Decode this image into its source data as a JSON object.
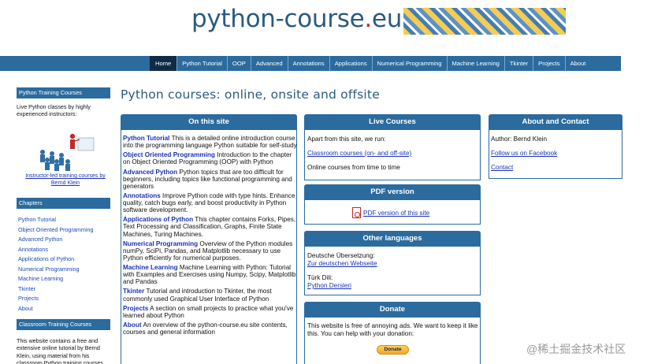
{
  "header": {
    "logo_main": "python-course",
    "logo_dot": ".",
    "logo_tld": "eu"
  },
  "nav": {
    "items": [
      "Home",
      "Python Tutorial",
      "OOP",
      "Advanced",
      "Annotations",
      "Applications",
      "Numerical Programming",
      "Machine Learning",
      "Tkinter",
      "Projects",
      "About"
    ]
  },
  "sidebar": {
    "training_head": "Python Training Courses",
    "training_text": "Live Python classes by highly experienced instructors:",
    "training_link": "Instructor-led training courses by Bernd Klein",
    "chapters_head": "Chapters",
    "chapters": [
      "Python Tutorial",
      "Object Oriented Programming",
      "Advanced Python",
      "Annotations",
      "Applications of Python",
      "Numerical Programming",
      "Machine Learning",
      "Tkinter",
      "Projects",
      "About"
    ],
    "classroom_head": "Classroom Training Courses",
    "classroom_text": "This website contains a free and extensive online tutorial by Bernd Klein, using material from his classroom Python training courses."
  },
  "main": {
    "title": "Python courses: online, onsite and offsite",
    "on_this_site": {
      "head": "On this site",
      "entries": [
        {
          "title": "Python Tutorial",
          "text": " This is a detailed online introduction course into the programming language Python suitable for self-study"
        },
        {
          "title": "Object Oriented Programming",
          "text": " Introduction to the chapter on Object Oriented Programming (OOP) with Python"
        },
        {
          "title": "Advanced Python",
          "text": " Python topics that are too difficult for beginners, including topics like functional programming and generators"
        },
        {
          "title": "Annotations",
          "text": " Improve Python code with type hints. Enhance quality, catch bugs early, and boost productivity in Python software development."
        },
        {
          "title": "Applications of Python",
          "text": " This chapter contains Forks, Pipes, Text Processing and Classification, Graphs, Finite State Machines, Turing Machines."
        },
        {
          "title": "Numerical Programming",
          "text": " Overview of the Python modules numPy, SciPi, Pandas, and Matplotlib necessary to use Python efficiently for numerical purposes."
        },
        {
          "title": "Machine Learning",
          "text": " Machine Learning with Python: Tutorial with Examples and Exercises using Numpy, Scipy, Matplotlib and Pandas"
        },
        {
          "title": "Tkinter",
          "text": " Tutorial and introduction to Tkinter, the most commonly used Graphical User Interface of Python"
        },
        {
          "title": "Projects",
          "text": " A section on small projects to practice what you've learned about Python"
        },
        {
          "title": "About",
          "text": " An overview of the python-course.eu site contents, courses and general information"
        }
      ]
    },
    "live_courses": {
      "head": "Live Courses",
      "line1": "Apart from this site, we run:",
      "link": "Classroom courses (on- and off-site)",
      "line3": "Online courses from time to time"
    },
    "pdf": {
      "head": "PDF version",
      "link": "PDF version of this site"
    },
    "languages": {
      "head": "Other languages",
      "de_label": "Deutsche Übersetzung:",
      "de_link": "Zur deutschen Webseite",
      "tr_label": "Türk Dili:",
      "tr_link": "Python Dersleri"
    },
    "donate": {
      "head": "Donate",
      "text": "This website is free of annoying ads. We want to keep it like this. You can help with your donation:",
      "button": "Donate"
    },
    "about": {
      "head": "About and Contact",
      "author": "Author: Bernd Klein",
      "facebook": "Follow us on Facebook",
      "contact": "Contact"
    }
  },
  "watermark": "@稀土掘金技术社区",
  "colors": {
    "brand_blue": "#2b6b9e",
    "nav_active": "#0f2b45",
    "link": "#1a33b5",
    "logo_dot": "#c62828"
  }
}
